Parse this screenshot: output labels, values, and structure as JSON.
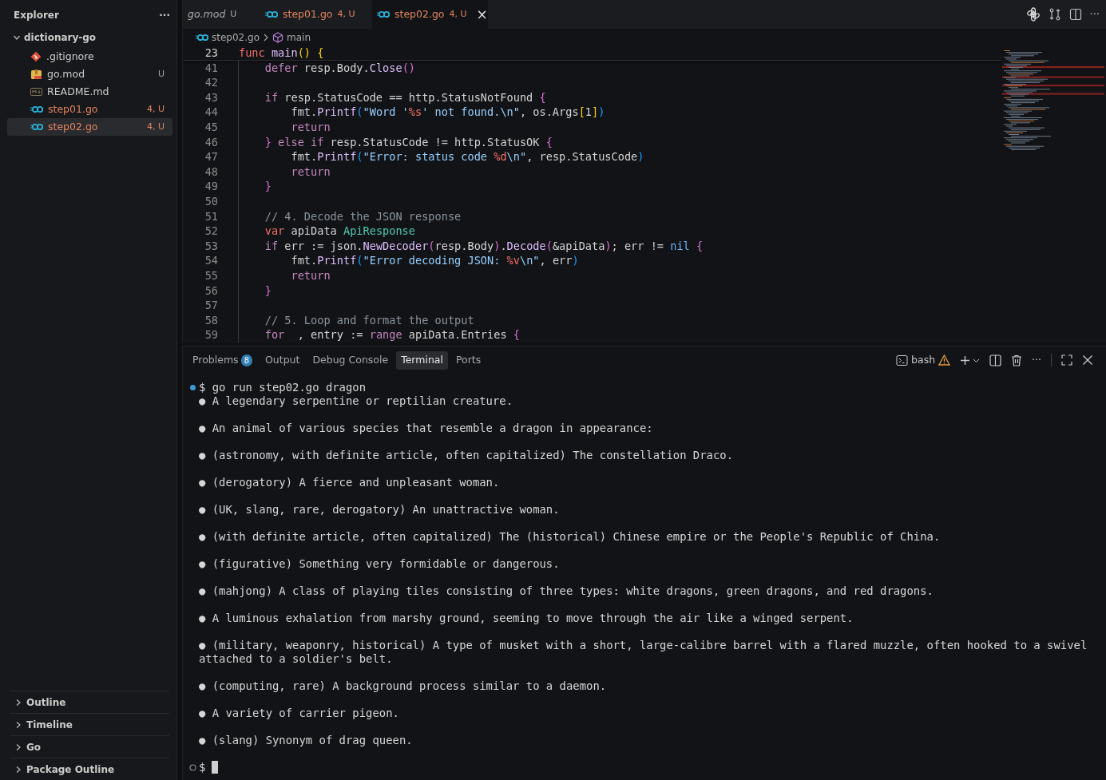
{
  "sidebar": {
    "title": "Explorer",
    "more": "···",
    "folder": {
      "name": "dictionary-go",
      "expanded": true,
      "files": [
        {
          "name": ".gitignore",
          "kind": "git",
          "problems": false,
          "selected": false
        },
        {
          "name": "go.mod",
          "kind": "gomod",
          "badge": "U",
          "problems": false,
          "selected": false
        },
        {
          "name": "README.md",
          "kind": "markdown",
          "problems": false,
          "selected": false
        },
        {
          "name": "step01.go",
          "kind": "go",
          "badge": "4, U",
          "problems": true,
          "selected": false
        },
        {
          "name": "step02.go",
          "kind": "go",
          "badge": "4, U",
          "problems": true,
          "selected": true
        }
      ]
    },
    "sections": [
      {
        "label": "Outline",
        "expanded": false
      },
      {
        "label": "Timeline",
        "expanded": false
      },
      {
        "label": "Go",
        "expanded": false
      },
      {
        "label": "Package Outline",
        "expanded": false
      }
    ]
  },
  "tabs": [
    {
      "label": "go.mod",
      "kind": "plain",
      "badge": "U",
      "problems": false,
      "preview": true,
      "selected": false
    },
    {
      "label": "step01.go",
      "kind": "go",
      "badge": "4, U",
      "problems": true,
      "preview": false,
      "selected": false
    },
    {
      "label": "step02.go",
      "kind": "go",
      "badge": "4, U",
      "problems": true,
      "preview": false,
      "selected": true,
      "close": "×"
    }
  ],
  "toolbar_more": "···",
  "breadcrumb": [
    {
      "label": "step02.go",
      "kind": "go"
    },
    {
      "label": "main",
      "kind": "symbol"
    }
  ],
  "sticky_line": {
    "number": "23",
    "tokens": [
      {
        "kind": "decl",
        "text": "func"
      },
      {
        "kind": "function",
        "text": " main"
      },
      {
        "kind": "bracket1",
        "text": "()"
      },
      {
        "kind": "bracket1",
        "text": " {"
      }
    ]
  },
  "code_lines": [
    {
      "number": "41",
      "tokens": [
        {
          "kind": "keyword",
          "text": "    defer"
        },
        {
          "kind": "plain",
          "text": " resp.Body."
        },
        {
          "kind": "function",
          "text": "Close"
        },
        {
          "kind": "bracket2",
          "text": "()"
        }
      ]
    },
    {
      "number": "42"
    },
    {
      "number": "43",
      "tokens": [
        {
          "kind": "keyword",
          "text": "    if"
        },
        {
          "kind": "plain",
          "text": " resp.StatusCode == http.StatusNotFound"
        },
        {
          "kind": "bracket2",
          "text": " {"
        }
      ]
    },
    {
      "number": "44",
      "tokens": [
        {
          "kind": "plain",
          "text": "        fmt."
        },
        {
          "kind": "function",
          "text": "Printf"
        },
        {
          "kind": "bracket3",
          "text": "("
        },
        {
          "kind": "string",
          "text": "\"Word '"
        },
        {
          "kind": "format",
          "text": "%s"
        },
        {
          "kind": "string",
          "text": "' not found.\\n\""
        },
        {
          "kind": "plain",
          "text": ", os.Args"
        },
        {
          "kind": "bracket1",
          "text": "["
        },
        {
          "kind": "plain",
          "text": "1"
        },
        {
          "kind": "bracket1",
          "text": "]"
        },
        {
          "kind": "bracket3",
          "text": ")"
        }
      ]
    },
    {
      "number": "45",
      "tokens": [
        {
          "kind": "keyword",
          "text": "        return"
        }
      ]
    },
    {
      "number": "46",
      "tokens": [
        {
          "kind": "bracket2",
          "text": "    }"
        },
        {
          "kind": "keyword",
          "text": " else if"
        },
        {
          "kind": "plain",
          "text": " resp.StatusCode != http.StatusOK"
        },
        {
          "kind": "bracket2",
          "text": " {"
        }
      ]
    },
    {
      "number": "47",
      "tokens": [
        {
          "kind": "plain",
          "text": "        fmt."
        },
        {
          "kind": "function",
          "text": "Printf"
        },
        {
          "kind": "bracket3",
          "text": "("
        },
        {
          "kind": "string",
          "text": "\"Error: status code "
        },
        {
          "kind": "format",
          "text": "%d"
        },
        {
          "kind": "string",
          "text": "\\n\""
        },
        {
          "kind": "plain",
          "text": ", resp.StatusCode"
        },
        {
          "kind": "bracket3",
          "text": ")"
        }
      ]
    },
    {
      "number": "48",
      "tokens": [
        {
          "kind": "keyword",
          "text": "        return"
        }
      ]
    },
    {
      "number": "49",
      "tokens": [
        {
          "kind": "bracket2",
          "text": "    }"
        }
      ]
    },
    {
      "number": "50"
    },
    {
      "number": "51",
      "tokens": [
        {
          "kind": "comment",
          "text": "    // 4. Decode the JSON response"
        }
      ]
    },
    {
      "number": "52",
      "tokens": [
        {
          "kind": "decl",
          "text": "    var"
        },
        {
          "kind": "plain",
          "text": " apiData"
        },
        {
          "kind": "type",
          "text": " ApiResponse"
        }
      ]
    },
    {
      "number": "53",
      "tokens": [
        {
          "kind": "keyword",
          "text": "    if"
        },
        {
          "kind": "plain",
          "text": " err := json."
        },
        {
          "kind": "function",
          "text": "NewDecoder"
        },
        {
          "kind": "bracket2",
          "text": "("
        },
        {
          "kind": "plain",
          "text": "resp.Body"
        },
        {
          "kind": "bracket2",
          "text": ")"
        },
        {
          "kind": "plain",
          "text": "."
        },
        {
          "kind": "function",
          "text": "Decode"
        },
        {
          "kind": "bracket2",
          "text": "("
        },
        {
          "kind": "plain",
          "text": "&apiData"
        },
        {
          "kind": "bracket2",
          "text": ")"
        },
        {
          "kind": "plain",
          "text": "; err !="
        },
        {
          "kind": "constant",
          "text": " nil"
        },
        {
          "kind": "bracket2",
          "text": " {"
        }
      ]
    },
    {
      "number": "54",
      "tokens": [
        {
          "kind": "plain",
          "text": "        fmt."
        },
        {
          "kind": "function",
          "text": "Printf"
        },
        {
          "kind": "bracket3",
          "text": "("
        },
        {
          "kind": "string",
          "text": "\"Error decoding JSON: "
        },
        {
          "kind": "format",
          "text": "%v"
        },
        {
          "kind": "string",
          "text": "\\n\""
        },
        {
          "kind": "plain",
          "text": ", err"
        },
        {
          "kind": "bracket3",
          "text": ")"
        }
      ]
    },
    {
      "number": "55",
      "tokens": [
        {
          "kind": "keyword",
          "text": "        return"
        }
      ]
    },
    {
      "number": "56",
      "tokens": [
        {
          "kind": "bracket2",
          "text": "    }"
        }
      ]
    },
    {
      "number": "57"
    },
    {
      "number": "58",
      "tokens": [
        {
          "kind": "comment",
          "text": "    // 5. Loop and format the output"
        }
      ]
    },
    {
      "number": "59",
      "tokens": [
        {
          "kind": "keyword",
          "text": "    for"
        },
        {
          "kind": "plain",
          "text": "  , entry :="
        },
        {
          "kind": "keyword",
          "text": " range"
        },
        {
          "kind": "plain",
          "text": " apiData.Entries"
        },
        {
          "kind": "bracket2",
          "text": " {"
        }
      ]
    }
  ],
  "panel_tabs": [
    {
      "label": "Problems",
      "count": "8",
      "selected": false
    },
    {
      "label": "Output",
      "selected": false
    },
    {
      "label": "Debug Console",
      "selected": false
    },
    {
      "label": "Terminal",
      "selected": true
    },
    {
      "label": "Ports",
      "selected": false
    }
  ],
  "terminal_toolbar": {
    "shell": "bash",
    "warning": true,
    "more": "···"
  },
  "terminal": [
    {
      "kind": "command",
      "finished": true,
      "text": "$ go run step02.go dragon"
    },
    {
      "kind": "entry",
      "text": "● A legendary serpentine or reptilian creature."
    },
    {
      "kind": "entry",
      "text": "● An animal of various species that resemble a dragon in appearance:"
    },
    {
      "kind": "entry",
      "text": "● (astronomy, with definite article, often capitalized) The constellation Draco."
    },
    {
      "kind": "entry",
      "text": "● (derogatory) A fierce and unpleasant woman."
    },
    {
      "kind": "entry",
      "text": "● (UK, slang, rare, derogatory) An unattractive woman."
    },
    {
      "kind": "entry",
      "text": "● (with definite article, often capitalized) The (historical) Chinese empire or the People's Republic of China."
    },
    {
      "kind": "entry",
      "text": "● (figurative) Something very formidable or dangerous."
    },
    {
      "kind": "entry",
      "text": "● (mahjong) A class of playing tiles consisting of three types: white dragons, green dragons, and red dragons."
    },
    {
      "kind": "entry",
      "text": "● A luminous exhalation from marshy ground, seeming to move through the air like a winged serpent."
    },
    {
      "kind": "entry",
      "text": "● (military, weaponry, historical) A type of musket with a short, large-calibre barrel with a flared muzzle, often hooked to a swivel attached to a soldier's belt."
    },
    {
      "kind": "entry",
      "text": "● (computing, rare) A background process similar to a daemon."
    },
    {
      "kind": "entry",
      "text": "● A variety of carrier pigeon."
    },
    {
      "kind": "entry",
      "text": "● (slang) Synonym of drag queen."
    },
    {
      "kind": "prompt",
      "finished": false,
      "text": "$"
    }
  ]
}
